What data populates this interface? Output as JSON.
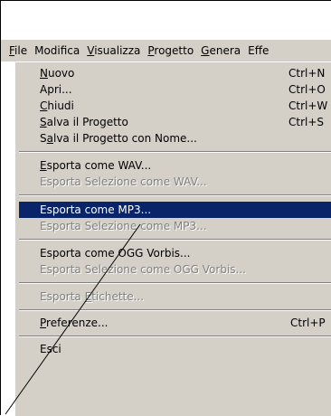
{
  "menubar": {
    "items": [
      {
        "pre": "",
        "u": "F",
        "post": "ile"
      },
      {
        "pre": "Modifica",
        "u": "",
        "post": ""
      },
      {
        "pre": "",
        "u": "V",
        "post": "isualizza"
      },
      {
        "pre": "",
        "u": "P",
        "post": "rogetto"
      },
      {
        "pre": "",
        "u": "G",
        "post": "enera"
      },
      {
        "pre": "Effe",
        "u": "",
        "post": ""
      }
    ]
  },
  "file_menu": {
    "items": [
      {
        "pre": "",
        "u": "N",
        "post": "uovo",
        "shortcut": "Ctrl+N"
      },
      {
        "pre": "Apri...",
        "u": "",
        "post": "",
        "shortcut": "Ctrl+O"
      },
      {
        "pre": "",
        "u": "C",
        "post": "hiudi",
        "shortcut": "Ctrl+W"
      },
      {
        "pre": "",
        "u": "S",
        "post": "alva il Progetto",
        "shortcut": "Ctrl+S"
      },
      {
        "pre": "S",
        "u": "a",
        "post": "lva il Progetto con Nome...",
        "shortcut": ""
      },
      {
        "pre": "",
        "u": "E",
        "post": "sporta come WAV...",
        "shortcut": ""
      },
      {
        "pre": "Esporta Selezione come WAV...",
        "u": "",
        "post": "",
        "shortcut": ""
      },
      {
        "pre": "Esporta come MP3...",
        "u": "",
        "post": "",
        "shortcut": ""
      },
      {
        "pre": "Esporta Selezione come MP3...",
        "u": "",
        "post": "",
        "shortcut": ""
      },
      {
        "pre": "Esporta come OGG Vorbis...",
        "u": "",
        "post": "",
        "shortcut": ""
      },
      {
        "pre": "Esporta Selezione come OGG Vorbis...",
        "u": "",
        "post": "",
        "shortcut": ""
      },
      {
        "pre": "Esporta ",
        "u": "E",
        "post": "tichette...",
        "shortcut": ""
      },
      {
        "pre": "",
        "u": "P",
        "post": "referenze...",
        "shortcut": "Ctrl+P"
      },
      {
        "pre": "Esci",
        "u": "",
        "post": "",
        "shortcut": ""
      }
    ]
  }
}
